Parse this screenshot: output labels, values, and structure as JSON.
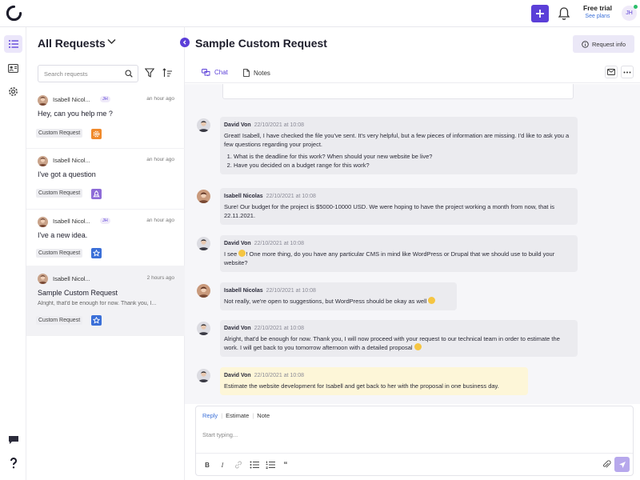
{
  "topbar": {
    "trial_title": "Free trial",
    "trial_link": "See plans",
    "avatar_initials": "JH"
  },
  "colors": {
    "accent": "#5b3fd8",
    "link": "#3a6fd8",
    "online": "#2bbf6a"
  },
  "list": {
    "title": "All Requests",
    "search_placeholder": "Search requests",
    "items": [
      {
        "author": "Isabell Nicol...",
        "badge": "JH",
        "time": "an hour ago",
        "subject": "Hey, can you help me ?",
        "preview": "",
        "tag": "Custom Request",
        "tag_icon": "gear-icon"
      },
      {
        "author": "Isabell Nicol...",
        "badge": "",
        "time": "an hour ago",
        "subject": "I've got a question",
        "preview": "",
        "tag": "Custom Request",
        "tag_icon": "rocket-icon"
      },
      {
        "author": "Isabell Nicol...",
        "badge": "JH",
        "time": "an hour ago",
        "subject": "I've a new idea.",
        "preview": "",
        "tag": "Custom Request",
        "tag_icon": "star-icon"
      },
      {
        "author": "Isabell Nicol...",
        "badge": "",
        "time": "2 hours ago",
        "subject": "Sample Custom Request",
        "preview": "Alright, that'd be enough for now. Thank you, I...",
        "tag": "Custom Request",
        "tag_icon": "star-icon"
      }
    ]
  },
  "main": {
    "title": "Sample Custom Request",
    "request_info": "Request info",
    "tabs": [
      {
        "label": "Chat"
      },
      {
        "label": "Notes"
      }
    ]
  },
  "messages": [
    {
      "name": "David Von",
      "time": "22/10/2021 at 10:08",
      "text": "Great! Isabell, I have checked the file you've sent. It's very helpful, but a few pieces of information are missing. I'd like to ask you a few questions regarding your project.",
      "list": [
        "What is the deadline for this work? When should your new website be live?",
        "Have you decided on a budget range for this work?"
      ]
    },
    {
      "name": "Isabell Nicolas",
      "time": "22/10/2021 at 10:08",
      "text": "Sure! Our budget for the project is $5000-10000 USD. We were hoping to have the project working a month from now, that is 22.11.2021."
    },
    {
      "name": "David Von",
      "time": "22/10/2021 at 10:08",
      "text_a": "I see ",
      "text_b": "! One more thing, do you have any particular CMS in mind like WordPress or Drupal that we should use to build your website?"
    },
    {
      "name": "Isabell Nicolas",
      "time": "22/10/2021 at 10:08",
      "text": "Not really, we're open to suggestions, but WordPress should be okay as well "
    },
    {
      "name": "David Von",
      "time": "22/10/2021 at 10:08",
      "text": "Alright, that'd be enough for now. Thank you, I will now proceed with your request to our technical team in order to estimate the work. I will get back to you tomorrow afternoon with a detailed proposal "
    },
    {
      "name": "David Von",
      "time": "22/10/2021 at 10:08",
      "text": "Estimate the website development for Isabell and get back to her with the proposal in one business day."
    }
  ],
  "composer": {
    "tabs": [
      "Reply",
      "Estimate",
      "Note"
    ],
    "placeholder": "Start typing..."
  }
}
